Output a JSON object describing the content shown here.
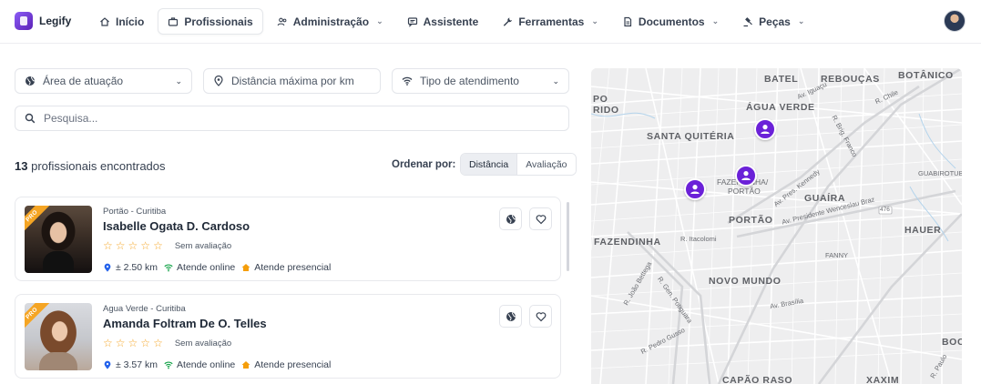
{
  "brand": {
    "name": "Legify"
  },
  "nav": [
    {
      "label": "Início",
      "icon": "home-icon",
      "dropdown": false,
      "active": false
    },
    {
      "label": "Profissionais",
      "icon": "briefcase-icon",
      "dropdown": false,
      "active": true
    },
    {
      "label": "Administração",
      "icon": "users-icon",
      "dropdown": true,
      "active": false
    },
    {
      "label": "Assistente",
      "icon": "chat-icon",
      "dropdown": false,
      "active": false
    },
    {
      "label": "Ferramentas",
      "icon": "wrench-icon",
      "dropdown": true,
      "active": false
    },
    {
      "label": "Documentos",
      "icon": "document-icon",
      "dropdown": true,
      "active": false
    },
    {
      "label": "Peças",
      "icon": "gavel-icon",
      "dropdown": true,
      "active": false
    }
  ],
  "filters": {
    "area": "Área de atuação",
    "distance": "Distância máxima por km",
    "service_type": "Tipo de atendimento",
    "search_placeholder": "Pesquisa..."
  },
  "results": {
    "count": "13",
    "count_label": "profissionais encontrados",
    "sort_label": "Ordenar por:",
    "sort_options": [
      "Distância",
      "Avaliação"
    ],
    "sort_active": "Distância"
  },
  "professionals": [
    {
      "location": "Portão - Curitiba",
      "name": "Isabelle Ogata D. Cardoso",
      "badge": "PRO",
      "rating_label": "Sem avaliação",
      "stars": 0,
      "distance": "± 2.50 km",
      "online": "Atende online",
      "presencial": "Atende presencial"
    },
    {
      "location": "Agua Verde - Curitiba",
      "name": "Amanda Foltram De O. Telles",
      "badge": "PRO",
      "rating_label": "Sem avaliação",
      "stars": 0,
      "distance": "± 3.57 km",
      "online": "Atende online",
      "presencial": "Atende presencial"
    }
  ],
  "map": {
    "neighborhoods": [
      "BATEL",
      "REBOUÇAS",
      "BOTÂNICO",
      "PO",
      "RIDO",
      "ÁGUA VERDE",
      "SANTA QUITÉRIA",
      "FAZENDINHA/",
      "PORTÃO",
      "GUAÍRA",
      "PORTÃO",
      "HAUER",
      "FAZENDINHA",
      "NOVO MUNDO",
      "BOC",
      "CAPÃO RASO",
      "XAXIM"
    ],
    "streets": [
      "Av. Iguaçu",
      "R. Chile",
      "R. Brig. Franco",
      "Av. Pres. Kennedy",
      "GUABIROTUBA",
      "Av. Presidente Wenceslau Braz",
      "476",
      "R. Itacolomi",
      "FANNY",
      "Av. Brasília",
      "R. João Bettega",
      "R. Gen. Potiguara",
      "R. Pedro Gusso",
      "R. Paulo"
    ],
    "pins": 3
  },
  "colors": {
    "accent": "#6b21d8",
    "star": "#f5a524",
    "presencial": "#f59e0b",
    "online": "#16a34a",
    "distance": "#2563eb"
  }
}
